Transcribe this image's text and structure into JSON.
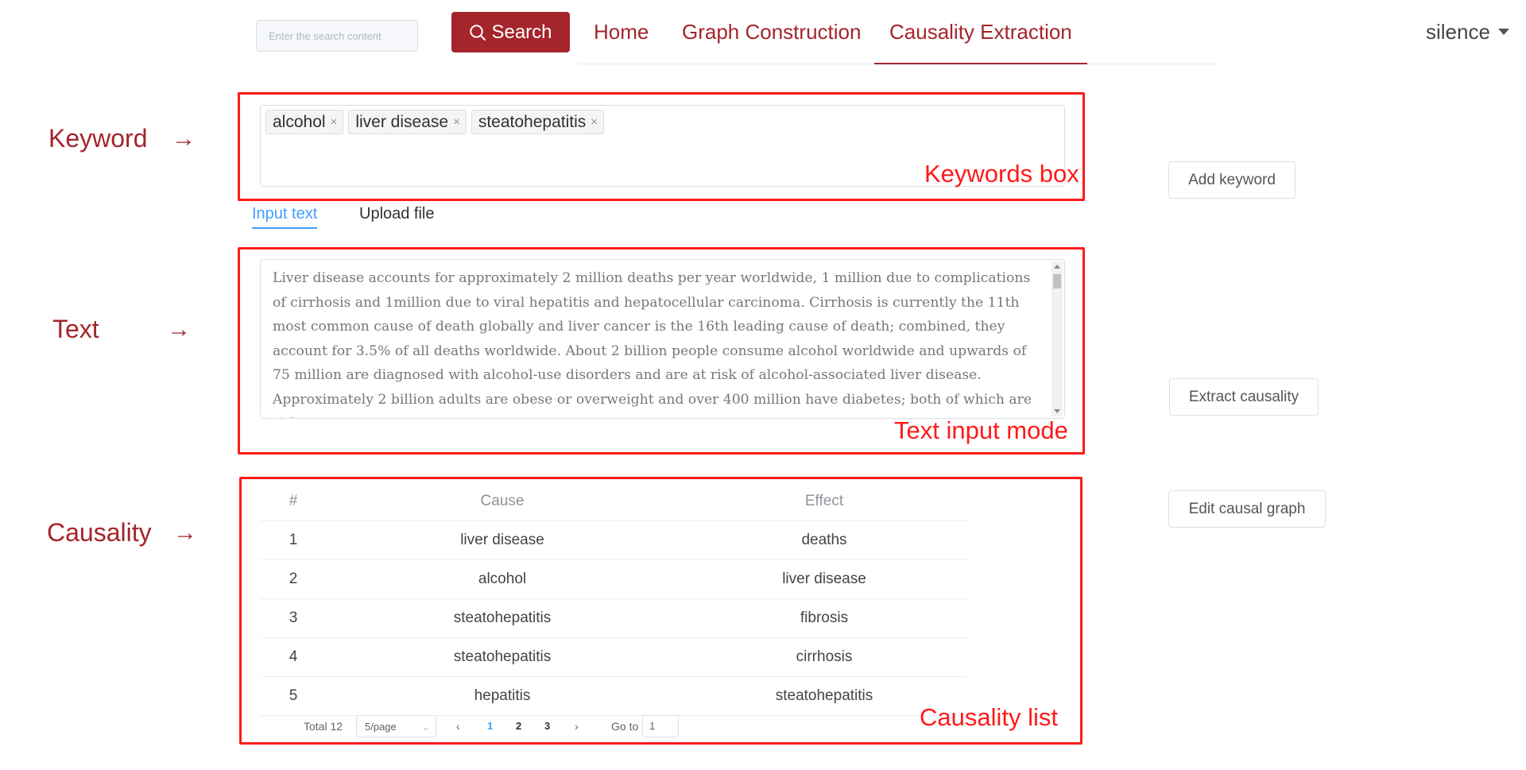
{
  "header": {
    "search_placeholder": "Enter the search content",
    "search_button": "Search",
    "nav": [
      {
        "label": "Home"
      },
      {
        "label": "Graph Construction"
      },
      {
        "label": "Causality Extraction"
      }
    ],
    "active_nav": "Causality Extraction",
    "user": "silence"
  },
  "labels": {
    "keyword": "Keyword",
    "text": "Text",
    "causality": "Causality",
    "arrow": "→"
  },
  "annotations": {
    "keywords_box": "Keywords box",
    "text_input_mode": "Text input mode",
    "causality_list": "Causality list"
  },
  "keywords": [
    "alcohol",
    "liver disease",
    "steatohepatitis"
  ],
  "tag_close_glyph": "×",
  "buttons": {
    "add_keyword": "Add keyword",
    "extract_causality": "Extract causality",
    "edit_causal_graph": "Edit causal graph"
  },
  "tabs": {
    "input_text": "Input text",
    "upload_file": "Upload file",
    "active": "Input text"
  },
  "text_input": "Liver disease accounts for approximately 2 million deaths per year worldwide, 1 million due to complications of cirrhosis and 1million due to viral hepatitis and hepatocellular carcinoma. Cirrhosis is currently the 11th most common cause of death globally and liver cancer is the 16th leading cause of death; combined, they account for 3.5% of all deaths worldwide. About 2 billion people consume alcohol worldwide and upwards of 75 million are diagnosed with alcohol-use disorders and are at risk of alcohol-associated liver disease. Approximately 2 billion adults are obese or overweight and over 400 million have diabetes; both of which are risk",
  "table": {
    "headers": {
      "index": "#",
      "cause": "Cause",
      "effect": "Effect"
    },
    "rows": [
      {
        "index": "1",
        "cause": "liver disease",
        "effect": "deaths"
      },
      {
        "index": "2",
        "cause": "alcohol",
        "effect": "liver disease"
      },
      {
        "index": "3",
        "cause": "steatohepatitis",
        "effect": "fibrosis"
      },
      {
        "index": "4",
        "cause": "steatohepatitis",
        "effect": "cirrhosis"
      },
      {
        "index": "5",
        "cause": "hepatitis",
        "effect": "steatohepatitis"
      }
    ]
  },
  "pagination": {
    "total": "Total 12",
    "page_size": "5/page",
    "pages": [
      "1",
      "2",
      "3"
    ],
    "current_page": "1",
    "goto_label": "Go to",
    "goto_value": "1",
    "prev_glyph": "‹",
    "next_glyph": "›"
  },
  "colors": {
    "brand": "#a4252b",
    "annotation_red": "#ff1a1a",
    "tab_active": "#409eff"
  }
}
